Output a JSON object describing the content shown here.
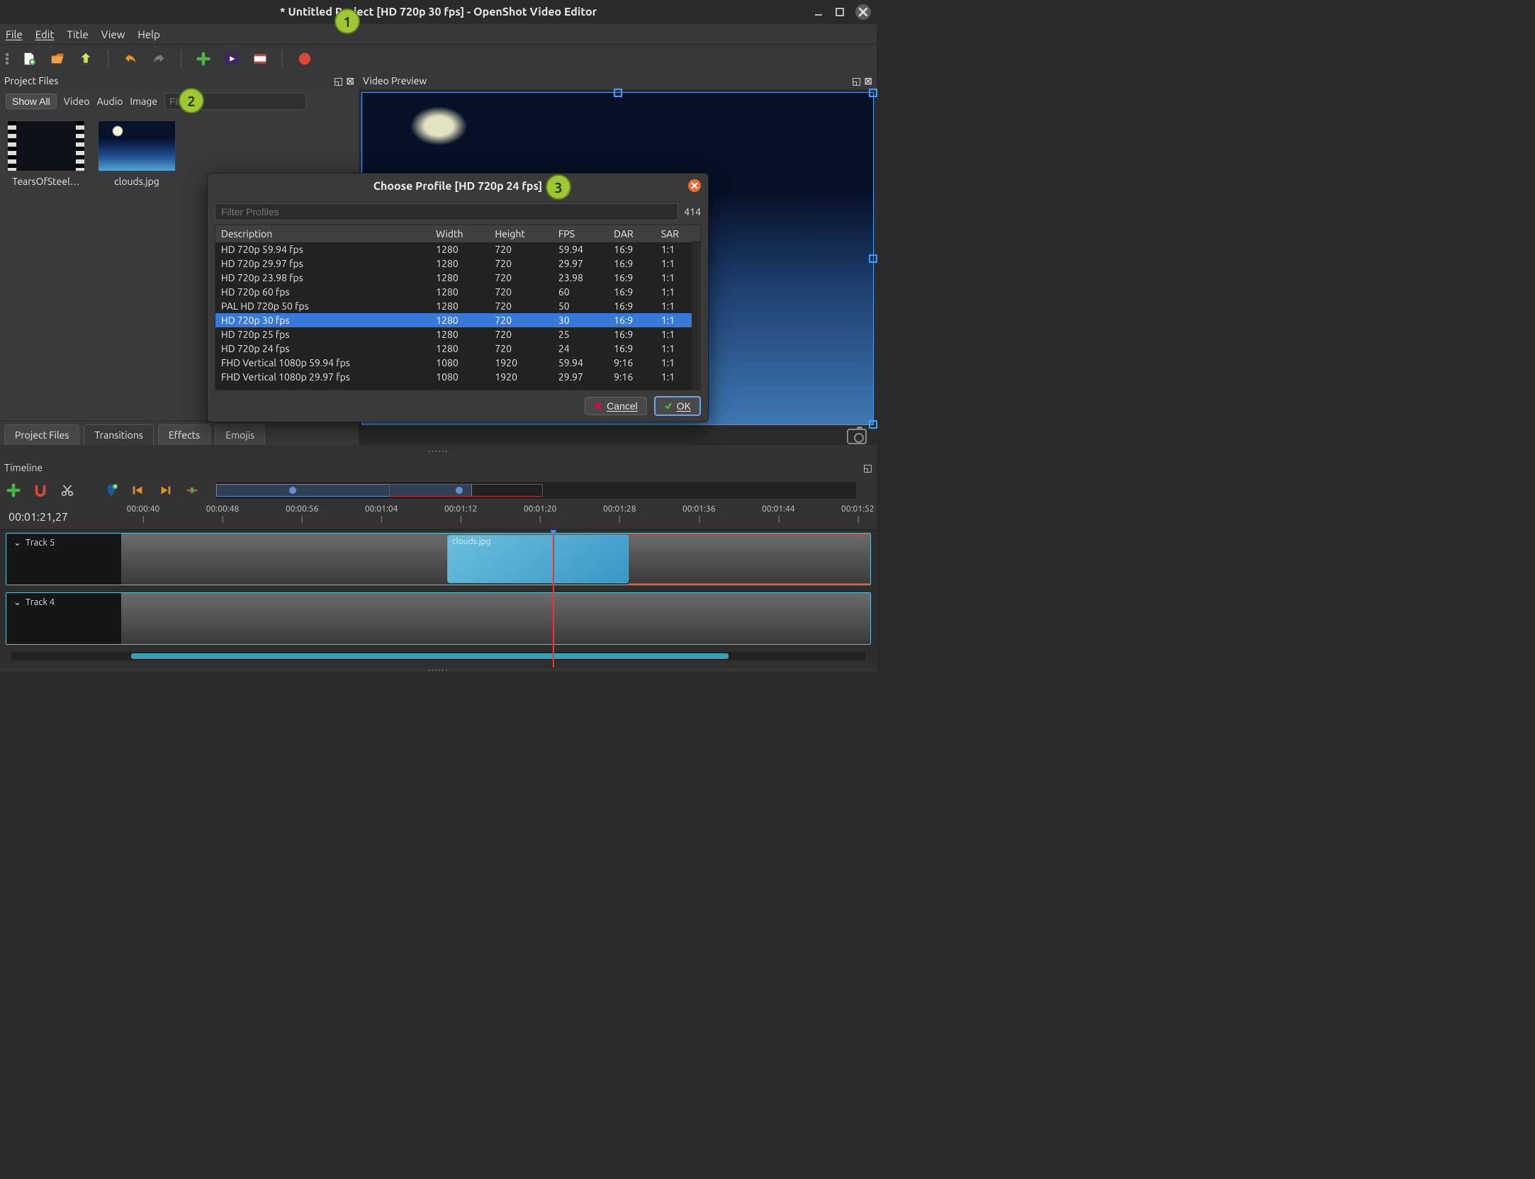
{
  "window": {
    "title": "* Untitled Project [HD 720p 30 fps] - OpenShot Video Editor"
  },
  "menu": {
    "file": "File",
    "edit": "Edit",
    "title_m": "Title",
    "view": "View",
    "help": "Help"
  },
  "panels": {
    "project_files": "Project Files",
    "video_preview": "Video Preview",
    "timeline": "Timeline"
  },
  "pf_filter": {
    "show_all": "Show All",
    "video": "Video",
    "audio": "Audio",
    "image": "Image",
    "placeholder": "Filter"
  },
  "pf_items": [
    {
      "label": "TearsOfSteel…",
      "kind": "video"
    },
    {
      "label": "clouds.jpg",
      "kind": "image"
    }
  ],
  "pf_tabs": {
    "project_files": "Project Files",
    "transitions": "Transitions",
    "effects": "Effects",
    "emojis": "Emojis"
  },
  "timeline": {
    "current_time": "00:01:21,27",
    "ticks": [
      "00:00:40",
      "00:00:48",
      "00:00:56",
      "00:01:04",
      "00:01:12",
      "00:01:20",
      "00:01:28",
      "00:01:36",
      "00:01:44",
      "00:01:52"
    ],
    "tracks": [
      {
        "name": "Track 5"
      },
      {
        "name": "Track 4"
      }
    ],
    "clip_label": "clouds.jpg"
  },
  "dialog": {
    "title": "Choose Profile [HD 720p 24 fps]",
    "filter_placeholder": "Filter Profiles",
    "count": "414",
    "columns": [
      "Description",
      "Width",
      "Height",
      "FPS",
      "DAR",
      "SAR"
    ],
    "rows": [
      {
        "desc": "HD 720p 59.94 fps",
        "w": "1280",
        "h": "720",
        "fps": "59.94",
        "dar": "16:9",
        "sar": "1:1",
        "sel": false
      },
      {
        "desc": "HD 720p 29.97 fps",
        "w": "1280",
        "h": "720",
        "fps": "29.97",
        "dar": "16:9",
        "sar": "1:1",
        "sel": false
      },
      {
        "desc": "HD 720p 23.98 fps",
        "w": "1280",
        "h": "720",
        "fps": "23.98",
        "dar": "16:9",
        "sar": "1:1",
        "sel": false
      },
      {
        "desc": "HD 720p 60 fps",
        "w": "1280",
        "h": "720",
        "fps": "60",
        "dar": "16:9",
        "sar": "1:1",
        "sel": false
      },
      {
        "desc": "PAL HD 720p 50 fps",
        "w": "1280",
        "h": "720",
        "fps": "50",
        "dar": "16:9",
        "sar": "1:1",
        "sel": false
      },
      {
        "desc": "HD 720p 30 fps",
        "w": "1280",
        "h": "720",
        "fps": "30",
        "dar": "16:9",
        "sar": "1:1",
        "sel": true
      },
      {
        "desc": "HD 720p 25 fps",
        "w": "1280",
        "h": "720",
        "fps": "25",
        "dar": "16:9",
        "sar": "1:1",
        "sel": false
      },
      {
        "desc": "HD 720p 24 fps",
        "w": "1280",
        "h": "720",
        "fps": "24",
        "dar": "16:9",
        "sar": "1:1",
        "sel": false
      },
      {
        "desc": "FHD Vertical 1080p 59.94 fps",
        "w": "1080",
        "h": "1920",
        "fps": "59.94",
        "dar": "9:16",
        "sar": "1:1",
        "sel": false
      },
      {
        "desc": "FHD Vertical 1080p 29.97 fps",
        "w": "1080",
        "h": "1920",
        "fps": "29.97",
        "dar": "9:16",
        "sar": "1:1",
        "sel": false
      }
    ],
    "cancel": "Cancel",
    "ok": "OK"
  },
  "badges": {
    "b1": "1",
    "b2": "2",
    "b3": "3"
  }
}
